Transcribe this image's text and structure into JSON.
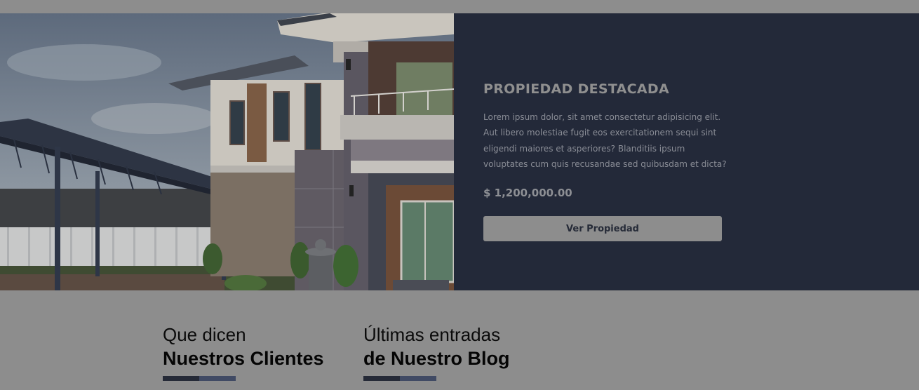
{
  "featured": {
    "title": "PROPIEDAD DESTACADA",
    "description": "Lorem ipsum dolor, sit amet consectetur adipisicing elit. Aut libero molestiae fugit eos exercitationem sequi sint eligendi maiores et asperiores? Blanditiis ipsum voluptates cum quis recusandae sed quibusdam et dicta?",
    "price": "$ 1,200,000.00",
    "button_label": "Ver Propiedad",
    "photo_icon": "house-photo"
  },
  "testimonials": {
    "subtitle": "Que dicen",
    "title": "Nuestros Clientes"
  },
  "blog": {
    "subtitle": "Últimas entradas",
    "title": "de Nuestro Blog"
  },
  "colors": {
    "overlay_gray": "#8d8d8d",
    "panel_navy": "#232939",
    "accent_dark": "#252a37",
    "accent_blue": "#404a64"
  }
}
